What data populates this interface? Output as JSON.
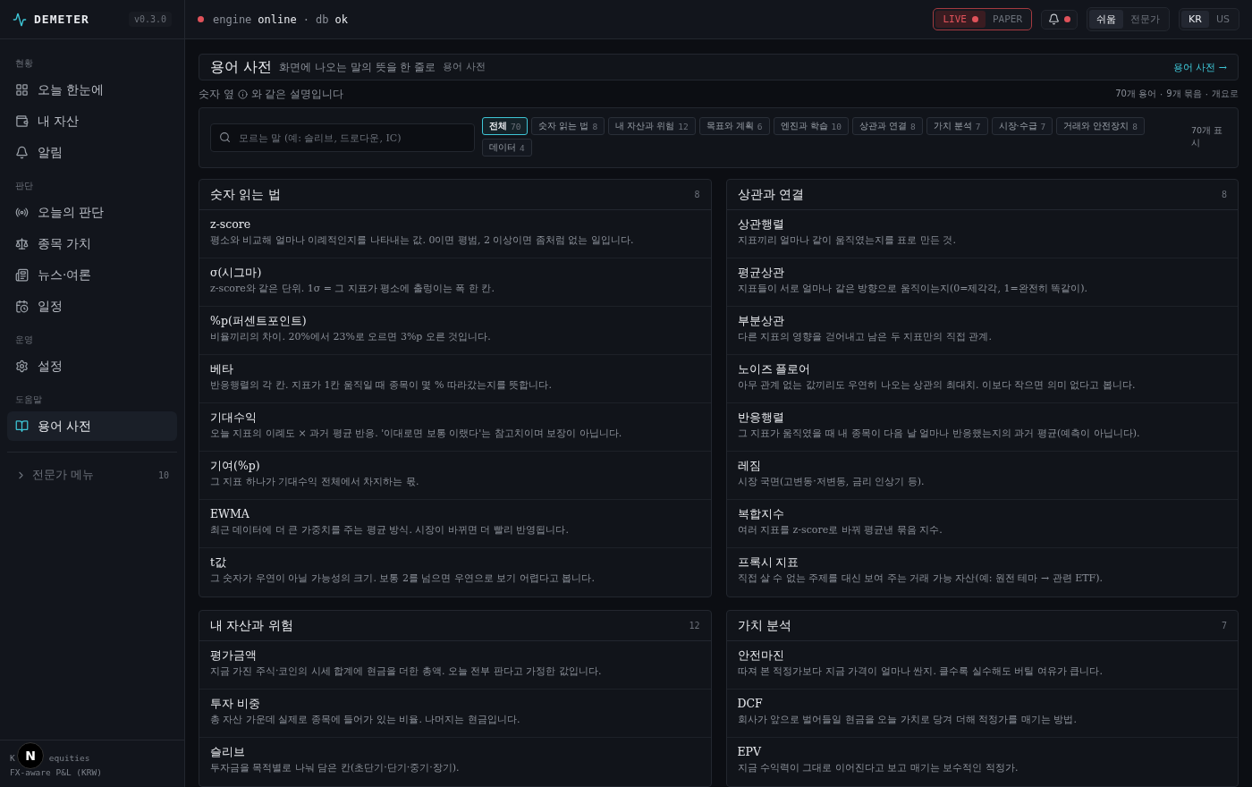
{
  "brand": {
    "name": "DEMETER",
    "version": "v0.3.0"
  },
  "status": {
    "engine_label": "engine",
    "engine_state": "online",
    "separator": "·",
    "db_label": "db",
    "db_state": "ok",
    "engine_alert": true
  },
  "mode_toggle": [
    {
      "label": "LIVE",
      "selected": true
    },
    {
      "label": "PAPER",
      "selected": false
    }
  ],
  "notifications": {
    "unread": true
  },
  "level_toggle": [
    {
      "label": "쉬움",
      "selected": true
    },
    {
      "label": "전문가",
      "selected": false
    }
  ],
  "market_toggle": [
    {
      "label": "KR",
      "selected": true
    },
    {
      "label": "US",
      "selected": false
    }
  ],
  "sidebar": {
    "groups": [
      {
        "label": "현황",
        "items": [
          {
            "label": "오늘 한눈에",
            "selected": false
          },
          {
            "label": "내 자산",
            "selected": false
          },
          {
            "label": "알림",
            "selected": false
          }
        ]
      },
      {
        "label": "판단",
        "items": [
          {
            "label": "오늘의 판단",
            "selected": false
          },
          {
            "label": "종목 가치",
            "selected": false
          },
          {
            "label": "뉴스·여론",
            "selected": false
          },
          {
            "label": "일정",
            "selected": false
          }
        ]
      },
      {
        "label": "운영",
        "items": [
          {
            "label": "설정",
            "selected": false
          }
        ]
      },
      {
        "label": "도움말",
        "items": [
          {
            "label": "용어 사전",
            "selected": true
          }
        ]
      }
    ],
    "expert_menu": {
      "label": "전문가 메뉴",
      "count": "10",
      "expanded": false
    },
    "footer": [
      [
        "K",
        "equities"
      ],
      [
        "FX-aware P&L (KRW)"
      ]
    ],
    "dev_badge": "N"
  },
  "header": {
    "title": "용어 사전",
    "subtitle": "화면에 나오는 말의 뜻을 한 줄로",
    "breadcrumb": "용어 사전",
    "link": "용어 사전 →"
  },
  "intro": {
    "before": "숫자 옆",
    "after": "와 같은 설명입니다",
    "stats": [
      "70개 용어",
      "9개 묶음",
      "개요로"
    ],
    "separator": "·"
  },
  "search": {
    "placeholder": "모르는 말 (예: 슬리브, 드로다운, IC)"
  },
  "filters": [
    {
      "label": "전체",
      "count": "70",
      "selected": true
    },
    {
      "label": "숫자 읽는 법",
      "count": "8",
      "selected": false
    },
    {
      "label": "내 자산과 위험",
      "count": "12",
      "selected": false
    },
    {
      "label": "목표와 계획",
      "count": "6",
      "selected": false
    },
    {
      "label": "엔진과 학습",
      "count": "10",
      "selected": false
    },
    {
      "label": "상관과 연결",
      "count": "8",
      "selected": false
    },
    {
      "label": "가치 분석",
      "count": "7",
      "selected": false
    },
    {
      "label": "시장·수급",
      "count": "7",
      "selected": false
    },
    {
      "label": "거래와 안전장치",
      "count": "8",
      "selected": false
    },
    {
      "label": "데이터",
      "count": "4",
      "selected": false
    }
  ],
  "shown_count": "70개 표시",
  "sections": [
    {
      "title": "숫자 읽는 법",
      "count": "8",
      "terms": [
        {
          "term": "z-score",
          "desc": "평소와 비교해 얼마나 이례적인지를 나타내는 값. 0이면 평범, 2 이상이면 좀처럼 없는 일입니다."
        },
        {
          "term": "σ(시그마)",
          "desc": "z-score와 같은 단위. 1σ = 그 지표가 평소에 출렁이는 폭 한 칸."
        },
        {
          "term": "%p(퍼센트포인트)",
          "desc": "비율끼리의 차이. 20%에서 23%로 오르면 3%p 오른 것입니다."
        },
        {
          "term": "베타",
          "desc": "반응행렬의 각 칸. 지표가 1칸 움직일 때 종목이 몇 % 따라갔는지를 뜻합니다."
        },
        {
          "term": "기대수익",
          "desc": "오늘 지표의 이례도 × 과거 평균 반응. '이대로면 보통 이랬다'는 참고치이며 보장이 아닙니다."
        },
        {
          "term": "기여(%p)",
          "desc": "그 지표 하나가 기대수익 전체에서 차지하는 몫."
        },
        {
          "term": "EWMA",
          "desc": "최근 데이터에 더 큰 가중치를 주는 평균 방식. 시장이 바뀌면 더 빨리 반영됩니다."
        },
        {
          "term": "t값",
          "desc": "그 숫자가 우연이 아닐 가능성의 크기. 보통 2를 넘으면 우연으로 보기 어렵다고 봅니다."
        }
      ]
    },
    {
      "title": "상관과 연결",
      "count": "8",
      "terms": [
        {
          "term": "상관행렬",
          "desc": "지표끼리 얼마나 같이 움직였는지를 표로 만든 것."
        },
        {
          "term": "평균상관",
          "desc": "지표들이 서로 얼마나 같은 방향으로 움직이는지(0=제각각, 1=완전히 똑같이)."
        },
        {
          "term": "부분상관",
          "desc": "다른 지표의 영향을 걷어내고 남은 두 지표만의 직접 관계."
        },
        {
          "term": "노이즈 플로어",
          "desc": "아무 관계 없는 값끼리도 우연히 나오는 상관의 최대치. 이보다 작으면 의미 없다고 봅니다."
        },
        {
          "term": "반응행렬",
          "desc": "그 지표가 움직였을 때 내 종목이 다음 날 얼마나 반응했는지의 과거 평균(예측이 아닙니다)."
        },
        {
          "term": "레짐",
          "desc": "시장 국면(고변동·저변동, 금리 인상기 등)."
        },
        {
          "term": "복합지수",
          "desc": "여러 지표를 z-score로 바꿔 평균낸 묶음 지수."
        },
        {
          "term": "프록시 지표",
          "desc": "직접 살 수 없는 주제를 대신 보여 주는 거래 가능 자산(예: 원전 테마 → 관련 ETF)."
        }
      ]
    },
    {
      "title": "내 자산과 위험",
      "count": "12",
      "terms": [
        {
          "term": "평가금액",
          "desc": "지금 가진 주식·코인의 시세 합계에 현금을 더한 총액. 오늘 전부 판다고 가정한 값입니다."
        },
        {
          "term": "투자 비중",
          "desc": "총 자산 가운데 실제로 종목에 들어가 있는 비율. 나머지는 현금입니다."
        },
        {
          "term": "슬리브",
          "desc": "투자금을 목적별로 나눠 담은 칸(초단기·단기·중기·장기)."
        }
      ]
    },
    {
      "title": "가치 분석",
      "count": "7",
      "terms": [
        {
          "term": "안전마진",
          "desc": "따져 본 적정가보다 지금 가격이 얼마나 싼지. 클수록 실수해도 버틸 여유가 큽니다."
        },
        {
          "term": "DCF",
          "desc": "회사가 앞으로 벌어들일 현금을 오늘 가치로 당겨 더해 적정가를 매기는 방법."
        },
        {
          "term": "EPV",
          "desc": "지금 수익력이 그대로 이어진다고 보고 매기는 보수적인 적정가."
        }
      ]
    }
  ]
}
